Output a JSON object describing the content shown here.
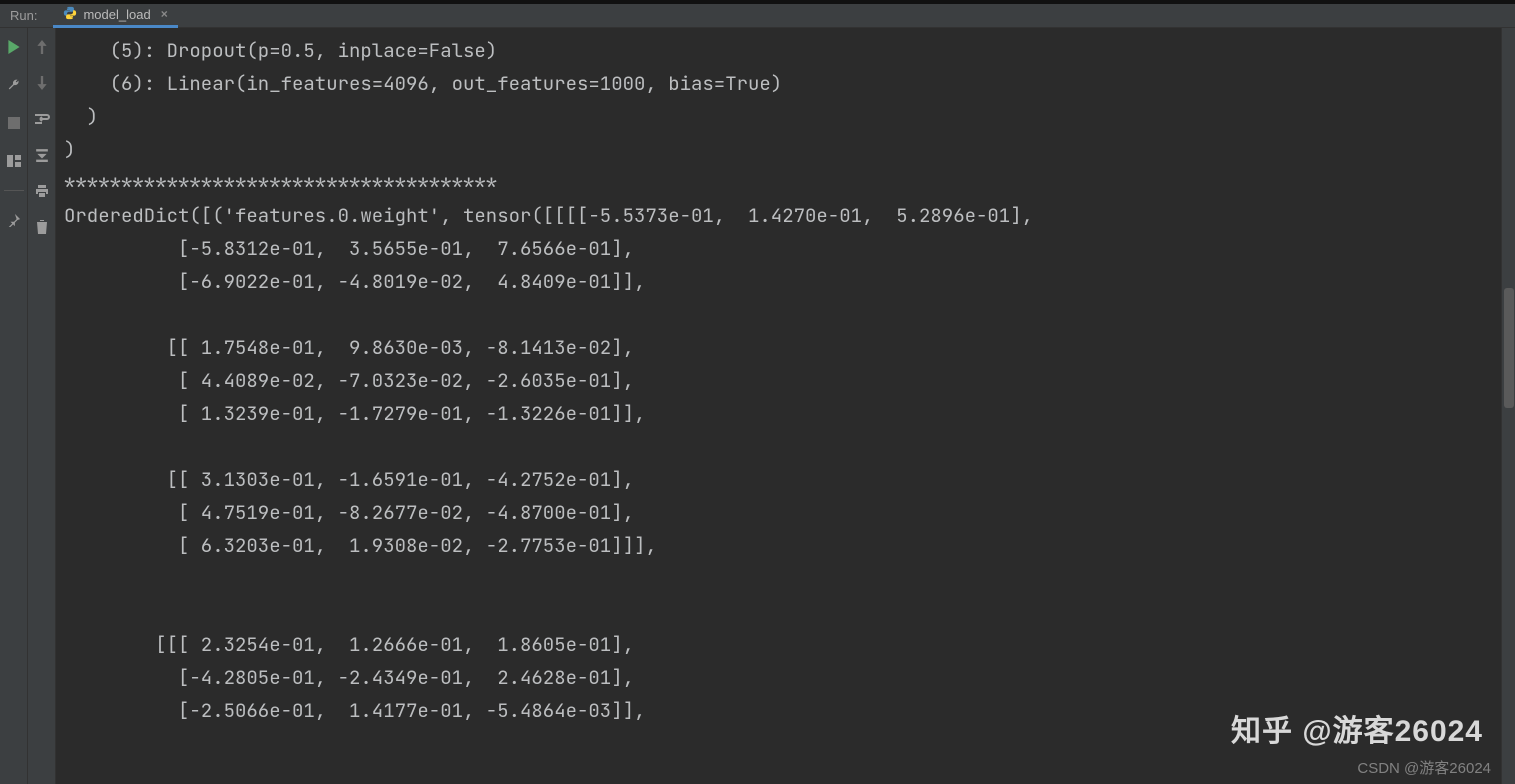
{
  "header": {
    "run_label": "Run:",
    "tab_name": "model_load"
  },
  "output": {
    "lines": [
      "    (5): Dropout(p=0.5, inplace=False)",
      "    (6): Linear(in_features=4096, out_features=1000, bias=True)",
      "  )",
      ")",
      "**************************************",
      "OrderedDict([('features.0.weight', tensor([[[[-5.5373e-01,  1.4270e-01,  5.2896e-01],",
      "          [-5.8312e-01,  3.5655e-01,  7.6566e-01],",
      "          [-6.9022e-01, -4.8019e-02,  4.8409e-01]],",
      "",
      "         [[ 1.7548e-01,  9.8630e-03, -8.1413e-02],",
      "          [ 4.4089e-02, -7.0323e-02, -2.6035e-01],",
      "          [ 1.3239e-01, -1.7279e-01, -1.3226e-01]],",
      "",
      "         [[ 3.1303e-01, -1.6591e-01, -4.2752e-01],",
      "          [ 4.7519e-01, -8.2677e-02, -4.8700e-01],",
      "          [ 6.3203e-01,  1.9308e-02, -2.7753e-01]]],",
      "",
      "",
      "        [[[ 2.3254e-01,  1.2666e-01,  1.8605e-01],",
      "          [-4.2805e-01, -2.4349e-01,  2.4628e-01],",
      "          [-2.5066e-01,  1.4177e-01, -5.4864e-03]],"
    ]
  },
  "icons": {
    "python": "python-icon",
    "close": "×",
    "play": "play-icon",
    "wrench": "wrench-icon",
    "stop": "stop-icon",
    "layout": "layout-icon",
    "pin": "pin-icon",
    "up": "up-arrow-icon",
    "down": "down-arrow-icon",
    "wrap": "softwrap-icon",
    "scroll": "scroll-to-end-icon",
    "print": "print-icon",
    "trash": "trash-icon"
  },
  "watermarks": {
    "zhihu": "知乎 @游客26024",
    "csdn": "CSDN @游客26024"
  }
}
